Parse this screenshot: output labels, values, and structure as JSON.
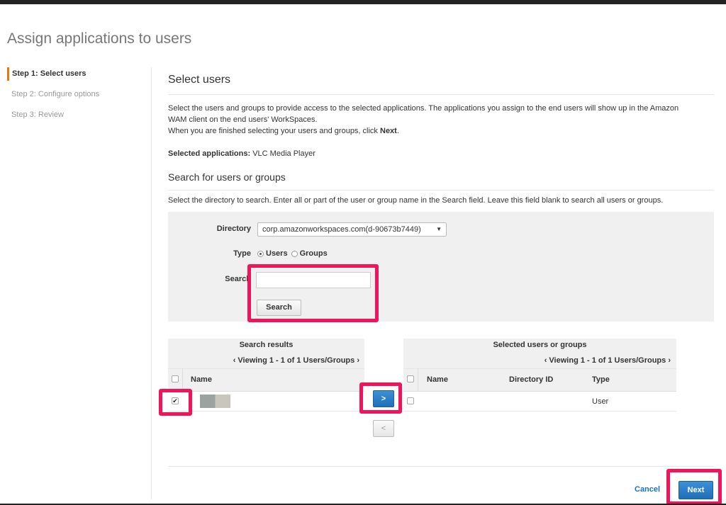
{
  "page": {
    "title": "Assign applications to users"
  },
  "steps": [
    {
      "label": "Step 1: Select users",
      "active": true
    },
    {
      "label": "Step 2: Configure options",
      "active": false
    },
    {
      "label": "Step 3: Review",
      "active": false
    }
  ],
  "select_users": {
    "heading": "Select users",
    "description_line1": "Select the users and groups to provide access to the selected applications. The applications you assign to the end users will show up in the Amazon",
    "description_line2": "WAM client on the end users' WorkSpaces.",
    "description_line3_prefix": "When you are finished selecting your users and groups, click ",
    "description_line3_bold": "Next",
    "description_line3_suffix": ".",
    "selected_apps_label": "Selected applications:",
    "selected_apps_value": "VLC Media Player"
  },
  "search_section": {
    "heading": "Search for users or groups",
    "description": "Select the directory to search. Enter all or part of the user or group name in the Search field. Leave this field blank to search all users or groups.",
    "directory_label": "Directory",
    "directory_value": "corp.amazonworkspaces.com(d-90673b7449)",
    "type_label": "Type",
    "type_options": [
      {
        "label": "Users",
        "selected": true
      },
      {
        "label": "Groups",
        "selected": false
      }
    ],
    "search_label": "Search",
    "search_value": "",
    "search_button": "Search"
  },
  "results": {
    "title": "Search results",
    "pager": "‹ Viewing 1 - 1 of 1 Users/Groups ›",
    "col_name": "Name",
    "rows": [
      {
        "checked": true,
        "name": ""
      }
    ]
  },
  "selected": {
    "title": "Selected users or groups",
    "pager": "‹ Viewing 1 - 1 of 1 Users/Groups ›",
    "col_name": "Name",
    "col_directory": "Directory ID",
    "col_type": "Type",
    "rows": [
      {
        "checked": false,
        "name": "",
        "directory_id": "",
        "type": "User"
      }
    ]
  },
  "transfer": {
    "add_label": ">",
    "remove_label": "<"
  },
  "footer": {
    "cancel_label": "Cancel",
    "next_label": "Next"
  },
  "colors": {
    "accent": "#e47911",
    "highlight": "#f0145a",
    "primary": "#1f6fb9"
  }
}
